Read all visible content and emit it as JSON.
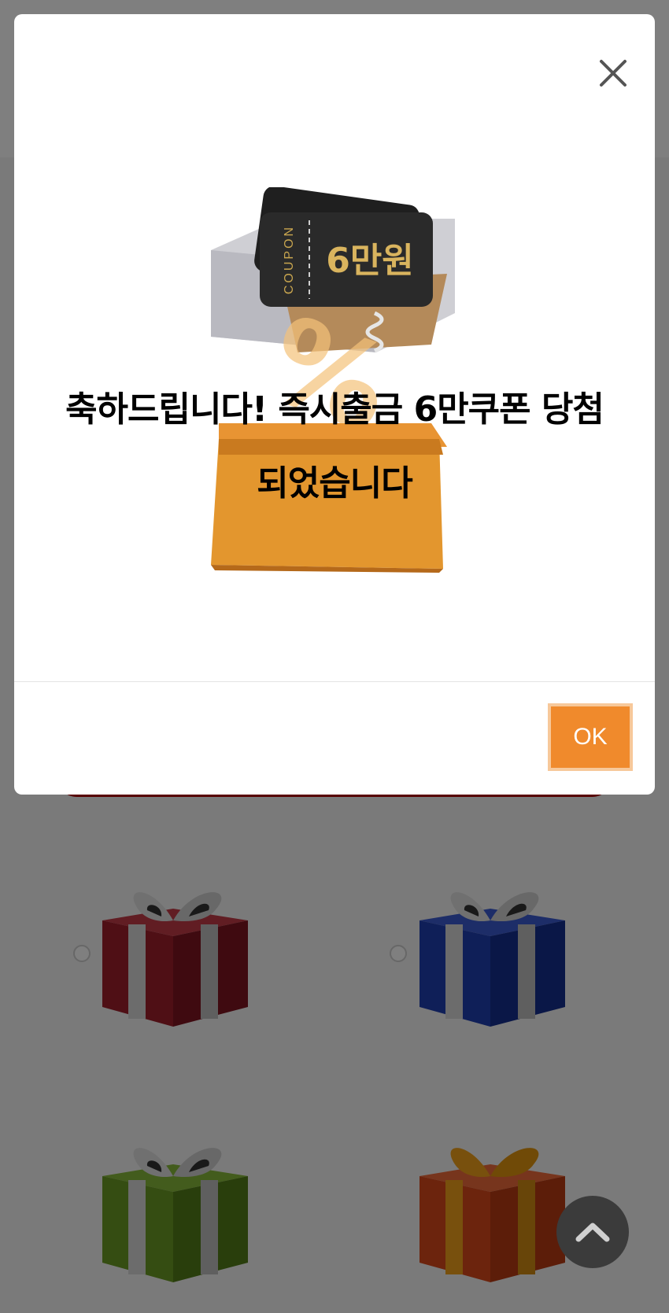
{
  "modal": {
    "message_line1": "축하드립니다! 즉시출금 6만쿠폰 당첨",
    "message_line2": "되었습니다",
    "ok_label": "OK",
    "close_icon": "close-icon"
  },
  "coupon_visual": {
    "coupon_label": "COUPON",
    "coupon_amount": "6만원",
    "percent_mark": "%"
  },
  "gifts": [
    {
      "color": "#9e1f2b",
      "ribbon": "#d9d9d9",
      "icon": "gift-box-red-icon"
    },
    {
      "color": "#1f3fb0",
      "ribbon": "#d9d9d9",
      "icon": "gift-box-blue-icon"
    },
    {
      "color": "#6a9a24",
      "ribbon": "#d9d9d9",
      "icon": "gift-box-green-icon"
    },
    {
      "color": "#d9481b",
      "ribbon": "#f0a11b",
      "icon": "gift-box-orange-icon"
    }
  ],
  "colors": {
    "accent": "#f08a2c",
    "overlay": "rgba(0,0,0,0.5)"
  }
}
